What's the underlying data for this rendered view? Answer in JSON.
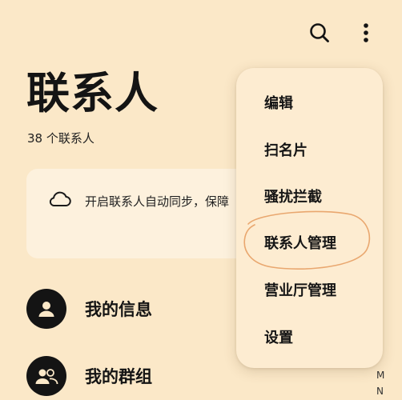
{
  "header": {
    "title": "联系人",
    "count": "38 个联系人",
    "search_icon": "search-icon",
    "more_icon": "more-vertical-icon"
  },
  "sync_card": {
    "text": "开启联系人自动同步，保障",
    "icon": "cloud-icon"
  },
  "list": {
    "my_info": "我的信息",
    "my_groups": "我的群组"
  },
  "menu": {
    "items": [
      "编辑",
      "扫名片",
      "骚扰拦截",
      "联系人管理",
      "营业厅管理",
      "设置"
    ],
    "highlighted": "联系人管理"
  },
  "alpha_index": [
    "M",
    "N"
  ],
  "colors": {
    "background": "#fbe8c8",
    "card": "#fdf1dd",
    "menu": "#fdecd1",
    "scribble": "#e9a76f"
  }
}
